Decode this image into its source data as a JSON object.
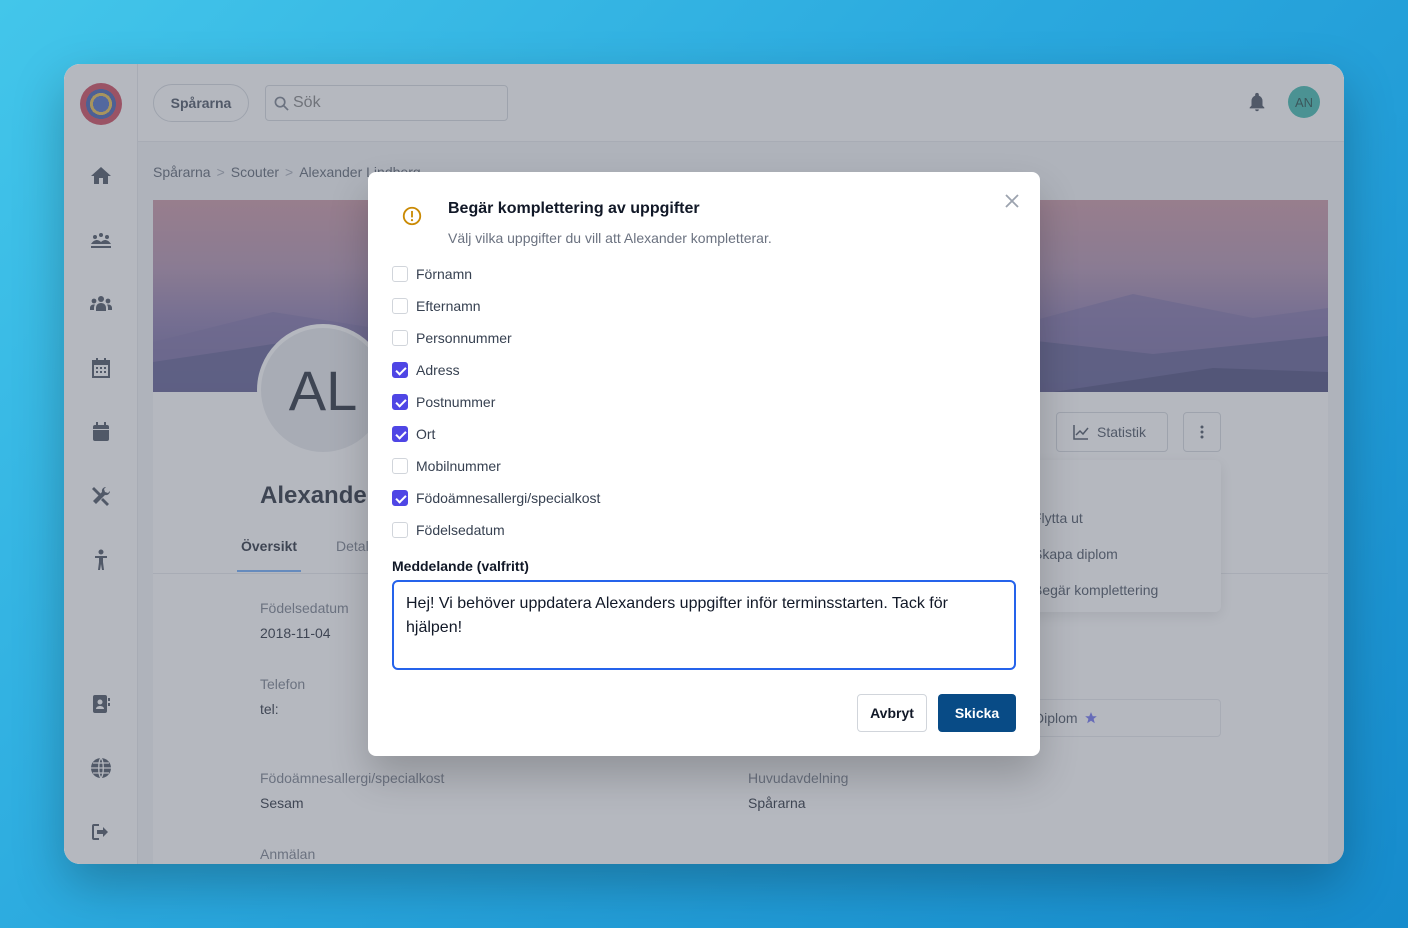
{
  "topbar": {
    "org_label": "Spårarna",
    "search_placeholder": "Sök",
    "avatar_initials": "AN"
  },
  "breadcrumb": [
    "Spårarna",
    "Scouter",
    "Alexander Lindberg"
  ],
  "profile": {
    "initials": "AL",
    "name": "Alexander Lindberg",
    "tabs": [
      "Översikt",
      "Detaljer"
    ],
    "stat_button": "Statistik",
    "dropdown_items": [
      "Flytta ut",
      "Skapa diplom",
      "Begär komplettering"
    ],
    "diplom_label": "Diplom",
    "fields": {
      "birthdate_label": "Födelsedatum",
      "birthdate_value": "2018-11-04",
      "phone_label": "Telefon",
      "phone_value": "tel:",
      "allergy_label": "Födoämnesallergi/specialkost",
      "allergy_value": "Sesam",
      "division_label": "Huvudavdelning",
      "division_value": "Spårarna",
      "registration_label": "Anmälan"
    }
  },
  "modal": {
    "title": "Begär komplettering av uppgifter",
    "subtitle": "Välj vilka uppgifter du vill att Alexander kompletterar.",
    "checkboxes": [
      {
        "label": "Förnamn",
        "checked": false
      },
      {
        "label": "Efternamn",
        "checked": false
      },
      {
        "label": "Personnummer",
        "checked": false
      },
      {
        "label": "Adress",
        "checked": true
      },
      {
        "label": "Postnummer",
        "checked": true
      },
      {
        "label": "Ort",
        "checked": true
      },
      {
        "label": "Mobilnummer",
        "checked": false
      },
      {
        "label": "Födoämnesallergi/specialkost",
        "checked": true
      },
      {
        "label": "Födelsedatum",
        "checked": false
      }
    ],
    "message_label": "Meddelande (valfritt)",
    "message_value": "Hej! Vi behöver uppdatera Alexanders uppgifter inför terminsstarten. Tack för hjälpen!",
    "cancel_label": "Avbryt",
    "send_label": "Skicka"
  },
  "colors": {
    "primary_button": "#084b86",
    "checkbox_checked": "#4f46e5",
    "warning_icon": "#ca8a04",
    "avatar_bg": "#2bb3a6"
  },
  "icons": {
    "sidebar": [
      "home-icon",
      "campfire-icon",
      "group-icon",
      "calendar-grid-icon",
      "calendar-icon",
      "tools-icon",
      "child-icon",
      "contacts-icon",
      "globe-icon",
      "logout-icon"
    ]
  }
}
